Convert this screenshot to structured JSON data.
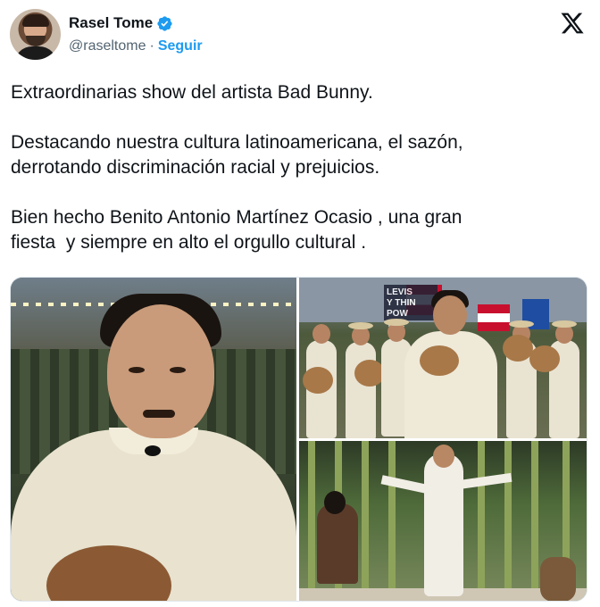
{
  "author": {
    "display_name": "Rasel Tome",
    "handle": "@raseltome",
    "separator": "·",
    "follow_label": "Seguir",
    "verified": true
  },
  "tweet": {
    "paragraphs": [
      "Extraordinarias show del artista Bad Bunny.",
      "Destacando nuestra cultura latinoamericana, el sazón,\nderrotando discriminación racial y prejuicios.",
      "Bien hecho Benito Antonio Martínez Ocasio , una gran\nfiesta  y siempre en alto el orgullo cultural ."
    ]
  },
  "media": {
    "photo_count": 3,
    "sign_text": "LEVIS\nY THIN\nPOW\nTHE"
  },
  "icons": {
    "brand": "x-logo-icon",
    "verified": "verified-badge-icon"
  },
  "colors": {
    "accent": "#1d9bf0",
    "text": "#0f1419",
    "secondary": "#536471"
  }
}
